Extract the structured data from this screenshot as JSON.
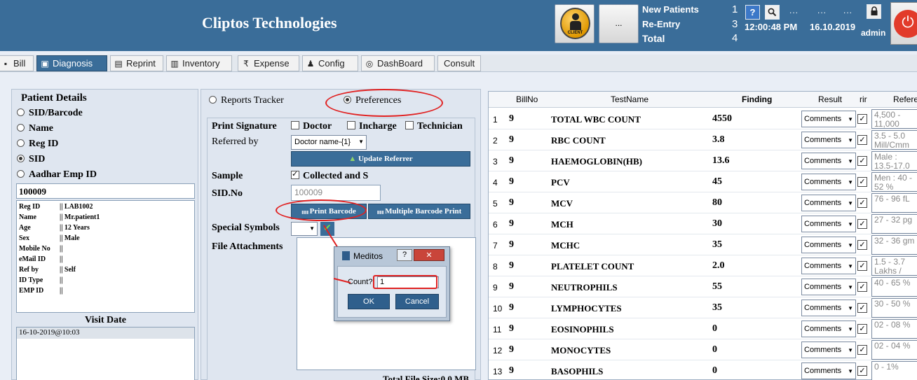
{
  "header": {
    "title": "Cliptos Technologies",
    "client_label": "CLIENT",
    "dots_label": "...",
    "stats": [
      {
        "label": "New Patients",
        "value": "1"
      },
      {
        "label": "Re-Entry",
        "value": "3"
      },
      {
        "label": "Total",
        "value": "4"
      }
    ],
    "dots_a": "...",
    "dots_b": "...",
    "dots_c": "...",
    "time": "12:00:48 PM",
    "date": "16.10.2019",
    "user": "admin",
    "help_glyph": "?",
    "power_glyph": "⏻"
  },
  "tabs": [
    {
      "label": "Bill",
      "icon": "bill-icon",
      "active": false
    },
    {
      "label": "Diagnosis",
      "icon": "diagnosis-icon",
      "active": true
    },
    {
      "label": "Reprint",
      "icon": "reprint-icon",
      "active": false
    },
    {
      "label": "Inventory",
      "icon": "inventory-icon",
      "active": false
    },
    {
      "label": "Expense",
      "icon": "rupee-icon",
      "active": false
    },
    {
      "label": "Config",
      "icon": "user-config-icon",
      "active": false
    },
    {
      "label": "DashBoard",
      "icon": "dashboard-icon",
      "active": false
    },
    {
      "label": "Consult",
      "icon": "",
      "active": false
    }
  ],
  "patient": {
    "title": "Patient Details",
    "search_options": [
      {
        "label": "SID/Barcode",
        "selected": false
      },
      {
        "label": "Name",
        "selected": false
      },
      {
        "label": "Reg ID",
        "selected": false
      },
      {
        "label": "SID",
        "selected": true
      },
      {
        "label": "Aadhar Emp ID",
        "selected": false
      }
    ],
    "search_value": "100009",
    "info": [
      {
        "key": "Reg ID",
        "value": "|| LAB1002"
      },
      {
        "key": "Name",
        "value": "|| Mr.patient1"
      },
      {
        "key": "Age",
        "value": "|| 12 Years"
      },
      {
        "key": "Sex",
        "value": "|| Male"
      },
      {
        "key": "Mobile No",
        "value": "||"
      },
      {
        "key": "eMail ID",
        "value": "||"
      },
      {
        "key": "Ref by",
        "value": "|| Self"
      },
      {
        "key": "ID Type",
        "value": "||"
      },
      {
        "key": "EMP ID",
        "value": "||"
      }
    ],
    "visit_title": "Visit Date",
    "visit_dates": [
      "16-10-2019@10:03"
    ]
  },
  "prefs": {
    "reports_tracker": "Reports Tracker",
    "preferences": "Preferences",
    "print_signature": "Print Signature",
    "doctor": "Doctor",
    "incharge": "Incharge",
    "technician": "Technician",
    "referred_by": "Referred by",
    "referrer_value": "Doctor name-{1}",
    "update_referrer": "Update Referrer",
    "sample": "Sample",
    "collected": "Collected and S",
    "sid_no": "SID.No",
    "sid_no_value": "100009",
    "print_barcode": "Print Barcode",
    "multiple_barcode": "Multiple Barcode Print",
    "special_symbols": "Special Symbols",
    "file_attachments": "File Attachments",
    "total_size": "Total File Size:0.0 MB"
  },
  "dialog": {
    "title": "Meditos",
    "help_glyph": "?",
    "close_glyph": "✕",
    "count_label": "Count?",
    "count_value": "1",
    "ok": "OK",
    "cancel": "Cancel"
  },
  "grid": {
    "headers": {
      "bill": "BillNo",
      "test": "TestName",
      "finding": "Finding",
      "result": "Result",
      "rir": "rir",
      "ref": "Referen"
    },
    "rows": [
      {
        "no": "1",
        "bill": "9",
        "test": "TOTAL WBC COUNT",
        "finding": "4550",
        "result": "Comments",
        "rir": true,
        "ref": "4,500 - 11,000"
      },
      {
        "no": "2",
        "bill": "9",
        "test": "RBC COUNT",
        "finding": "3.8",
        "result": "Comments",
        "rir": true,
        "ref": "3.5 - 5.0 Mill/Cmm"
      },
      {
        "no": "3",
        "bill": "9",
        "test": "HAEMOGLOBIN(HB)",
        "finding": "13.6",
        "result": "Comments",
        "rir": true,
        "ref": "Male : 13.5-17.0"
      },
      {
        "no": "4",
        "bill": "9",
        "test": "PCV",
        "finding": "45",
        "result": "Comments",
        "rir": true,
        "ref": "Men : 40 - 52 %"
      },
      {
        "no": "5",
        "bill": "9",
        "test": "MCV",
        "finding": "80",
        "result": "Comments",
        "rir": true,
        "ref": "76 - 96 fL"
      },
      {
        "no": "6",
        "bill": "9",
        "test": "MCH",
        "finding": "30",
        "result": "Comments",
        "rir": true,
        "ref": "27 - 32 pg"
      },
      {
        "no": "7",
        "bill": "9",
        "test": "MCHC",
        "finding": "35",
        "result": "Comments",
        "rir": true,
        "ref": "32 - 36 gm"
      },
      {
        "no": "8",
        "bill": "9",
        "test": "PLATELET COUNT",
        "finding": "2.0",
        "result": "Comments",
        "rir": true,
        "ref": "1.5 - 3.7 Lakhs /"
      },
      {
        "no": "9",
        "bill": "9",
        "test": "NEUTROPHILS",
        "finding": "55",
        "result": "Comments",
        "rir": true,
        "ref": "40 - 65 %"
      },
      {
        "no": "10",
        "bill": "9",
        "test": "LYMPHOCYTES",
        "finding": "35",
        "result": "Comments",
        "rir": true,
        "ref": "30 - 50 %"
      },
      {
        "no": "11",
        "bill": "9",
        "test": "EOSINOPHILS",
        "finding": "0",
        "result": "Comments",
        "rir": true,
        "ref": "02 - 08 %"
      },
      {
        "no": "12",
        "bill": "9",
        "test": "MONOCYTES",
        "finding": "0",
        "result": "Comments",
        "rir": true,
        "ref": "02 - 04 %"
      },
      {
        "no": "13",
        "bill": "9",
        "test": "BASOPHILS",
        "finding": "0",
        "result": "Comments",
        "rir": true,
        "ref": "0 - 1%"
      }
    ]
  },
  "colors": {
    "header_bg": "#3a6d99",
    "accent": "#3a6d99",
    "annotation": "#e02020"
  }
}
